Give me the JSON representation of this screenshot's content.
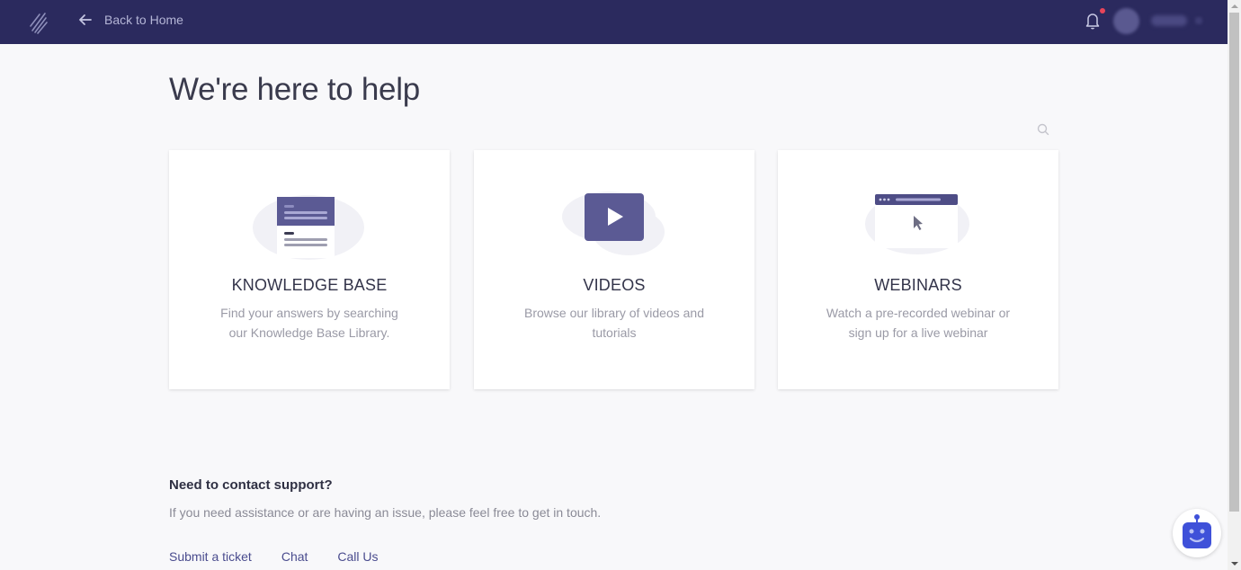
{
  "header": {
    "back_label": "Back to Home",
    "notification_badge": true,
    "user_name": "(blurred)"
  },
  "page": {
    "title": "We're here to help"
  },
  "cards": [
    {
      "title": "KNOWLEDGE BASE",
      "description": "Find your answers by searching our Knowledge Base Library.",
      "icon": "document-icon"
    },
    {
      "title": "VIDEOS",
      "description": "Browse our library of videos and tutorials",
      "icon": "play-icon"
    },
    {
      "title": "WEBINARS",
      "description": "Watch a pre-recorded webinar or sign up for a live webinar",
      "icon": "browser-window-icon"
    }
  ],
  "contact": {
    "title": "Need to contact support?",
    "text": "If you need assistance or are having an issue, please feel free to get in touch.",
    "links": [
      "Submit a ticket",
      "Chat",
      "Call Us"
    ]
  },
  "colors": {
    "header_bg": "#2b2a5e",
    "accent": "#5b5a94",
    "link": "#4a4c8e",
    "bot": "#3f51d9",
    "badge": "#e8455a"
  }
}
